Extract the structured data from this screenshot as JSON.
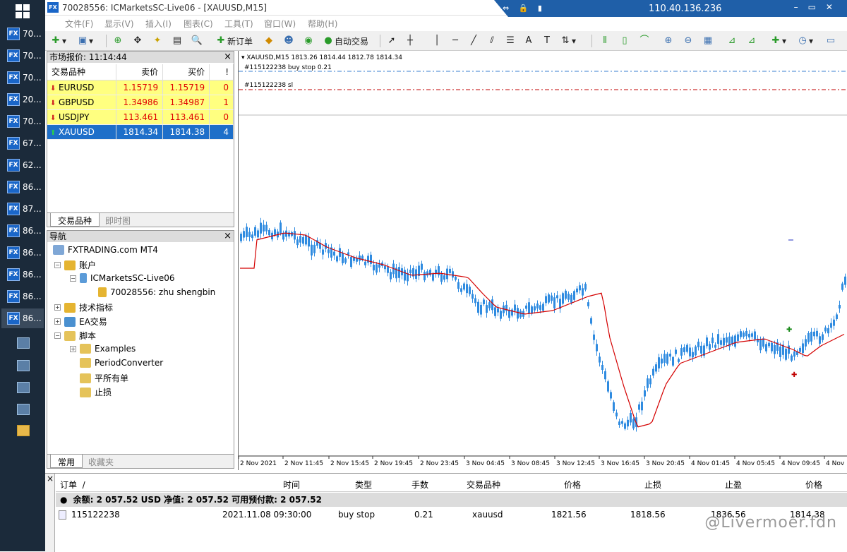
{
  "window_title": "70028556: ICMarketsSC-Live06 - [XAUUSD,M15]",
  "remote_ip": "110.40.136.236",
  "taskbar": {
    "items": [
      "70...",
      "70...",
      "70...",
      "20...",
      "70...",
      "67...",
      "62...",
      "86...",
      "87...",
      "86...",
      "86...",
      "86...",
      "86...",
      "86..."
    ]
  },
  "menu": [
    "文件(F)",
    "显示(V)",
    "插入(I)",
    "图表(C)",
    "工具(T)",
    "窗口(W)",
    "帮助(H)"
  ],
  "toolbar": {
    "new_order": "新订单",
    "auto_trade": "自动交易"
  },
  "market_watch": {
    "title": "市场报价: 11:14:44",
    "headers": {
      "symbol": "交易品种",
      "bid": "卖价",
      "ask": "买价",
      "excl": "!"
    },
    "rows": [
      {
        "symbol": "EURUSD",
        "bid": "1.15719",
        "ask": "1.15719",
        "spread": "0",
        "dir": "down"
      },
      {
        "symbol": "GBPUSD",
        "bid": "1.34986",
        "ask": "1.34987",
        "spread": "1",
        "dir": "down"
      },
      {
        "symbol": "USDJPY",
        "bid": "113.461",
        "ask": "113.461",
        "spread": "0",
        "dir": "down"
      },
      {
        "symbol": "XAUUSD",
        "bid": "1814.34",
        "ask": "1814.38",
        "spread": "4",
        "dir": "up"
      }
    ],
    "tabs": [
      "交易品种",
      "即时图"
    ]
  },
  "navigator": {
    "title": "导航",
    "root": "FXTRADING.com MT4",
    "accounts": "账户",
    "server": "ICMarketsSC-Live06",
    "user": "70028556: zhu shengbin",
    "indicators": "技术指标",
    "ea": "EA交易",
    "scripts": "脚本",
    "script_items": [
      "Examples",
      "PeriodConverter",
      "平所有单",
      "止损"
    ],
    "tabs": [
      "常用",
      "收藏夹"
    ]
  },
  "chart": {
    "header": "XAUUSD,M15  1813.26 1814.44 1812.78 1814.34",
    "order_line": "#115122238 buy stop 0.21",
    "sl_line": "#115122238 sl",
    "x_labels": [
      "2 Nov 2021",
      "2 Nov 11:45",
      "2 Nov 15:45",
      "2 Nov 19:45",
      "2 Nov 23:45",
      "3 Nov 04:45",
      "3 Nov 08:45",
      "3 Nov 12:45",
      "3 Nov 16:45",
      "3 Nov 20:45",
      "4 Nov 01:45",
      "4 Nov 05:45",
      "4 Nov 09:45",
      "4 Nov"
    ],
    "colors": {
      "candle": "#2f8be0",
      "ma": "#d40000",
      "order_line": "#3a7fd0",
      "sl_line": "#c00000"
    }
  },
  "terminal": {
    "headers": [
      "订单",
      "时间",
      "类型",
      "手数",
      "交易品种",
      "价格",
      "止损",
      "止盈",
      "价格"
    ],
    "balance": "余额: 2 057.52 USD  净值: 2 057.52  可用预付款: 2 057.52",
    "order": {
      "id": "115122238",
      "time": "2021.11.08 09:30:00",
      "type": "buy stop",
      "lots": "0.21",
      "symbol": "xauusd",
      "price": "1821.56",
      "sl": "1818.56",
      "tp": "1836.56",
      "cur": "1814.38"
    }
  },
  "watermark": "@Livermoer.fdn"
}
